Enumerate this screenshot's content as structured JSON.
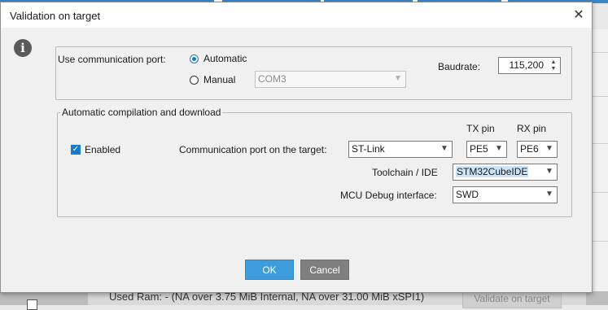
{
  "dialog": {
    "title": "Validation on target",
    "close_glyph": "✕"
  },
  "comm": {
    "use_port_label": "Use communication port:",
    "automatic_label": "Automatic",
    "manual_label": "Manual",
    "selected": "Automatic",
    "manual_port_value": "COM3",
    "baudrate_label": "Baudrate:",
    "baudrate_value": "115,200"
  },
  "auto": {
    "group_title": "Automatic compilation and download",
    "enabled_label": "Enabled",
    "enabled_checked": true,
    "tx_pin_header": "TX pin",
    "rx_pin_header": "RX pin",
    "port_on_target_label": "Communication port on the target:",
    "port_on_target_value": "ST-Link",
    "tx_pin_value": "PE5",
    "rx_pin_value": "PE6",
    "toolchain_label": "Toolchain / IDE",
    "toolchain_value": "STM32CubeIDE",
    "debug_label": "MCU Debug interface:",
    "debug_value": "SWD"
  },
  "buttons": {
    "ok": "OK",
    "cancel": "Cancel"
  },
  "background": {
    "used_ram": "Used Ram: - (NA over 3.75 MiB Internal, NA over 31.00 MiB xSPI1)",
    "validate_button": "Validate on target"
  },
  "icons": {
    "info": "info-icon",
    "dropdown": "chevron-down-icon",
    "close": "close-icon"
  },
  "colors": {
    "accent": "#1979ca",
    "ok_button": "#3d9ddc",
    "cancel_button": "#7f7f7f",
    "top_bar": "#3c87c9"
  }
}
